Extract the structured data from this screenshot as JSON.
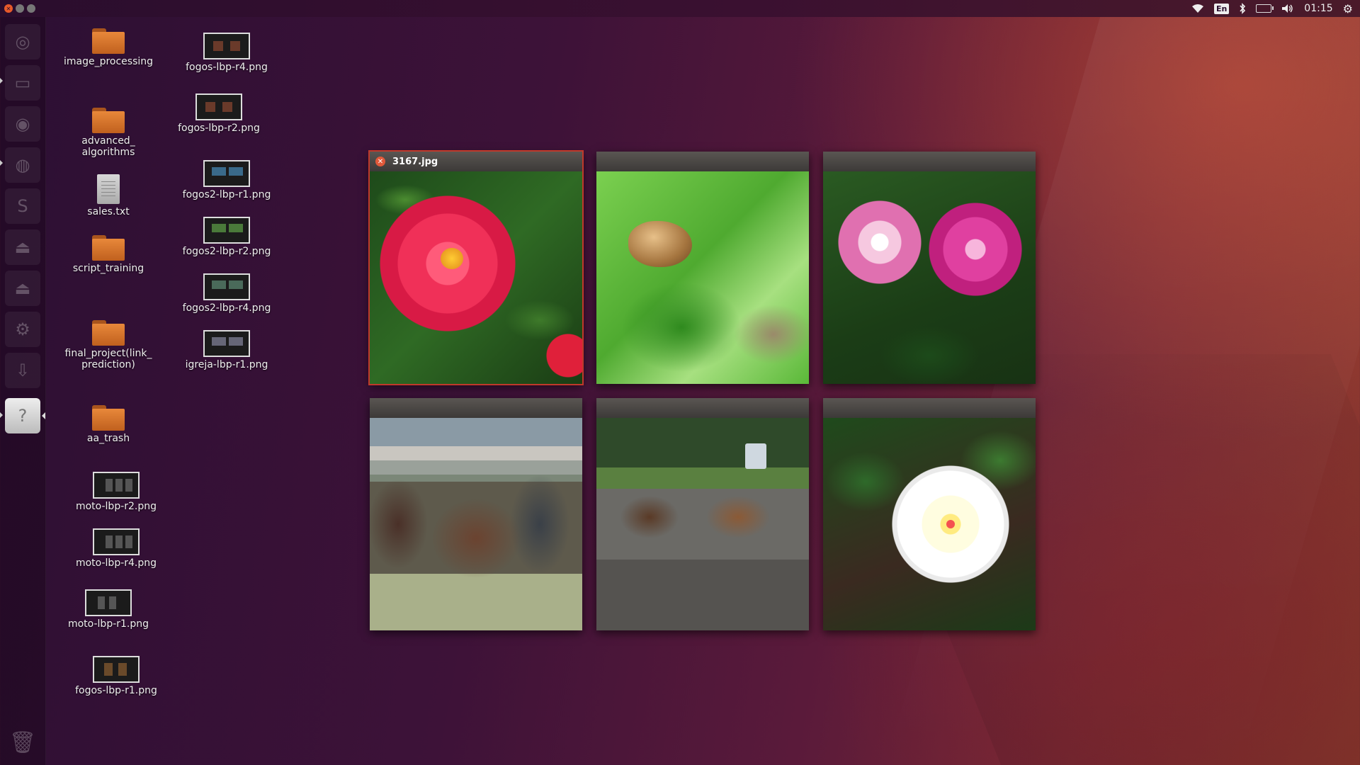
{
  "panel": {
    "window_controls": [
      "close",
      "minimize",
      "maximize"
    ],
    "keyboard_layout": "En",
    "clock": "01:15",
    "indicators": [
      "wifi-icon",
      "keyboard-layout-indicator",
      "bluetooth-icon",
      "battery-icon",
      "volume-icon",
      "gear-icon"
    ]
  },
  "launcher": {
    "items": [
      {
        "name": "ubuntu-dash-icon",
        "glyph": "◎"
      },
      {
        "name": "files-icon",
        "glyph": "▭"
      },
      {
        "name": "chromium-icon",
        "glyph": "◉"
      },
      {
        "name": "firefox-icon",
        "glyph": "◍"
      },
      {
        "name": "terminal-icon",
        "glyph": "S"
      },
      {
        "name": "drive-icon",
        "glyph": "⏏"
      },
      {
        "name": "drive-icon-2",
        "glyph": "⏏"
      },
      {
        "name": "settings-icon",
        "glyph": "⚙"
      },
      {
        "name": "download-icon",
        "glyph": "⇩"
      },
      {
        "name": "help-icon",
        "glyph": "?"
      }
    ],
    "trash_glyph": "🗑"
  },
  "desktop": {
    "icons": [
      {
        "type": "folder",
        "label": "image_processing"
      },
      {
        "type": "folder",
        "label": "advanced_\nalgorithms"
      },
      {
        "type": "text",
        "label": "sales.txt"
      },
      {
        "type": "folder",
        "label": "script_training"
      },
      {
        "type": "folder",
        "label": "final_project(link_\nprediction)"
      },
      {
        "type": "folder",
        "label": "aa_trash"
      },
      {
        "type": "image",
        "label": "moto-lbp-r2.png"
      },
      {
        "type": "image",
        "label": "moto-lbp-r4.png"
      },
      {
        "type": "image",
        "label": "moto-lbp-r1.png"
      },
      {
        "type": "image",
        "label": "fogos-lbp-r1.png"
      },
      {
        "type": "image",
        "label": "fogos-lbp-r4.png"
      },
      {
        "type": "image",
        "label": "fogos-lbp-r2.png"
      },
      {
        "type": "image",
        "label": "fogos2-lbp-r1.png"
      },
      {
        "type": "image",
        "label": "fogos2-lbp-r2.png"
      },
      {
        "type": "image",
        "label": "fogos2-lbp-r4.png"
      },
      {
        "type": "image",
        "label": "igreja-lbp-r1.png"
      }
    ]
  },
  "spread": {
    "windows": [
      {
        "title": "3167.jpg",
        "photo": "red-camellia",
        "active": true
      },
      {
        "title": "",
        "photo": "beetle-on-leaf",
        "active": false
      },
      {
        "title": "",
        "photo": "pink-peonies",
        "active": false
      },
      {
        "title": "",
        "photo": "horse-market",
        "active": false
      },
      {
        "title": "",
        "photo": "two-horses",
        "active": false
      },
      {
        "title": "",
        "photo": "white-peony",
        "active": false
      }
    ]
  },
  "colors": {
    "accent_close": "#e0593a",
    "active_outline": "#c0392b",
    "folder": "#e8883a"
  }
}
